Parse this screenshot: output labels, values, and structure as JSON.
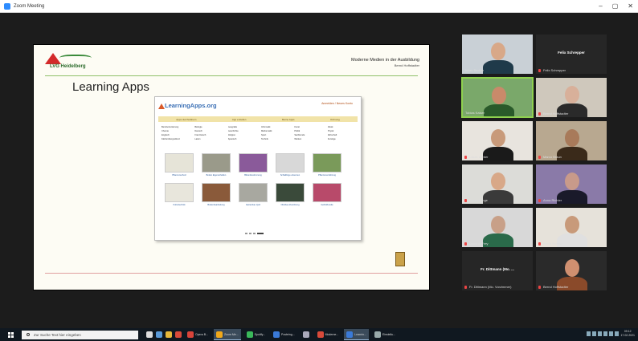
{
  "window": {
    "title": "Zoom Meeting",
    "controls": [
      "–",
      "▢",
      "✕"
    ]
  },
  "slide": {
    "logo_text": "LVG Heidelberg",
    "header_line1": "Moderne Medien in der Ausbildung",
    "header_line2": "Bernd Hoffstadter",
    "title": "Learning Apps"
  },
  "website": {
    "logo": "LearningApps.org",
    "login": "Anmelden / Neues Konto",
    "nav": [
      "Apps durchstöbern",
      "App erstellen",
      "Meine Apps",
      "Ordnung"
    ],
    "categories": [
      [
        "Berufsorientierung",
        "Biologie",
        "Geografie",
        "Informatik",
        "Kunst",
        "Musik"
      ],
      [
        "Chemie",
        "Deutsch",
        "Geschichte",
        "Mathematik",
        "Politik",
        "Physik"
      ],
      [
        "Englisch",
        "Französisch",
        "Religion",
        "Sport",
        "Sachkunde",
        "Wirtschaft"
      ],
      [
        "Fächerübergreifend",
        "Latein",
        "Spanisch",
        "Technik",
        "Werken",
        "Sonstige"
      ]
    ],
    "tiles": [
      {
        "caption": "Pflanzenschutz",
        "color": "#e6e4d8"
      },
      {
        "caption": "Boden Eigenschaften",
        "color": "#9a9a8a"
      },
      {
        "caption": "Blütenbestimmung",
        "color": "#8a5a9a"
      },
      {
        "caption": "Schädlinge erkennen",
        "color": "#d8d8d8"
      },
      {
        "caption": "Pflanzenernährung",
        "color": "#7a9a5a"
      },
      {
        "caption": "Kulturtechnik",
        "color": "#e8e6dc"
      },
      {
        "caption": "Bodenbearbeitung",
        "color": "#8a5a3a"
      },
      {
        "caption": "Gartenbau Quiz",
        "color": "#a8a8a0"
      },
      {
        "caption": "Obstbau Zuordnung",
        "color": "#3a4a3a"
      },
      {
        "caption": "Gehölzkunde",
        "color": "#b84a6a"
      }
    ]
  },
  "participants": [
    {
      "label": "Julian Becker",
      "center_name": "",
      "mic_muted": false,
      "active": false,
      "bg": "#c9d0d6",
      "skin": "#d8a888",
      "shirt": "#1f3a4a"
    },
    {
      "label": "Felix Schrepper",
      "center_name": "Felix Schrepper",
      "mic_muted": true,
      "active": false,
      "bg": "#262626",
      "skin": "",
      "shirt": ""
    },
    {
      "label": "Tobias Kaiser",
      "center_name": "",
      "mic_muted": false,
      "active": true,
      "bg": "#7aa86a",
      "skin": "#c98a6a",
      "shirt": "#2a5a2a"
    },
    {
      "label": "Bernd Hoffstadter",
      "center_name": "",
      "mic_muted": true,
      "active": false,
      "bg": "#cfc8bc",
      "skin": "#d8b09a",
      "shirt": "#2a2a2a"
    },
    {
      "label": "Lukas Weber",
      "center_name": "",
      "mic_muted": true,
      "active": false,
      "bg": "#e8e4de",
      "skin": "#c89a7a",
      "shirt": "#1a1a1a"
    },
    {
      "label": "Marco Braun",
      "center_name": "",
      "mic_muted": true,
      "active": false,
      "bg": "#b8a890",
      "skin": "#a87a5a",
      "shirt": "#3a2a1a"
    },
    {
      "label": "Sarah Lange",
      "center_name": "",
      "mic_muted": true,
      "active": false,
      "bg": "#dcdcd8",
      "skin": "#d8a888",
      "shirt": "#3a3a3a"
    },
    {
      "label": "Anna Richter",
      "center_name": "",
      "mic_muted": true,
      "active": false,
      "bg": "#8a7aa8",
      "skin": "#c89a8a",
      "shirt": "#1a1a2a"
    },
    {
      "label": "Dominik Frey",
      "center_name": "",
      "mic_muted": true,
      "active": false,
      "bg": "#d8d8d8",
      "skin": "#c8a088",
      "shirt": "#2a6a4a"
    },
    {
      "label": "Kevin Schmitt",
      "center_name": "",
      "mic_muted": true,
      "active": false,
      "bg": "#e6e2da",
      "skin": "#c89a7a",
      "shirt": "#e0e0e0"
    },
    {
      "label": "Fr. Dittmann (Mo. Vorzimmer)",
      "center_name": "Fr. Dittmann (Mo. ...",
      "mic_muted": true,
      "active": false,
      "bg": "#262626",
      "skin": "",
      "shirt": ""
    },
    {
      "label": "Bernd Hoffstadter",
      "center_name": "",
      "mic_muted": true,
      "active": false,
      "bg": "#2a2a2a",
      "skin": "#d09070",
      "shirt": "#8a4a2a"
    }
  ],
  "taskbar": {
    "search_placeholder": "Zur Suche Text hier eingeben",
    "pinned_colors": [
      "#ddd",
      "#5a9ad8",
      "#e8b83a",
      "#d84a3a"
    ],
    "apps": [
      {
        "label": "Opera B...",
        "color": "#d8443a",
        "active": false
      },
      {
        "label": "Zoom Me...",
        "color": "#f0a81a",
        "active": true
      },
      {
        "label": "Spotify...",
        "color": "#3ab85a",
        "active": false
      },
      {
        "label": "Posteing...",
        "color": "#3a7ad8",
        "active": false
      },
      {
        "label": "",
        "color": "#aab",
        "active": false
      },
      {
        "label": "Moderne...",
        "color": "#d84a3a",
        "active": false
      },
      {
        "label": "Learnin...",
        "color": "#3a7ad8",
        "active": true
      },
      {
        "label": "Einstellu...",
        "color": "#9aa",
        "active": false
      }
    ],
    "time": "09:12",
    "date": "17.02.2021"
  }
}
